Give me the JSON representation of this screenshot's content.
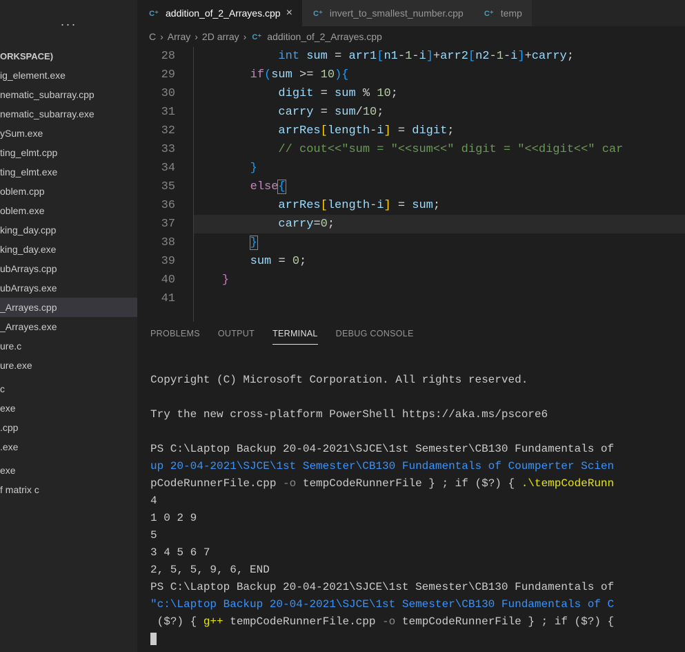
{
  "sidebar": {
    "workspace_label": "ORKSPACE)",
    "files": [
      "ig_element.exe",
      "nematic_subarray.cpp",
      "nematic_subarray.exe",
      "ySum.exe",
      "ting_elmt.cpp",
      "ting_elmt.exe",
      "oblem.cpp",
      "oblem.exe",
      "king_day.cpp",
      "king_day.exe",
      "ubArrays.cpp",
      "ubArrays.exe",
      "_Arrayes.cpp",
      "_Arrayes.exe",
      "ure.c",
      "ure.exe",
      "",
      "c",
      "exe",
      ".cpp",
      ".exe",
      "",
      "exe",
      "f matrix c"
    ],
    "active_index": 12
  },
  "tabs": {
    "items": [
      {
        "label": "addition_of_2_Arrayes.cpp",
        "active": true,
        "close": true
      },
      {
        "label": "invert_to_smallest_number.cpp",
        "active": false,
        "close": false
      },
      {
        "label": "temp",
        "active": false,
        "close": false
      }
    ]
  },
  "breadcrumb": {
    "parts": [
      "C",
      "Array",
      "2D array",
      "addition_of_2_Arrayes.cpp"
    ]
  },
  "editor": {
    "line_start": 28,
    "line_end": 41
  },
  "panel": {
    "tabs": [
      "PROBLEMS",
      "OUTPUT",
      "TERMINAL",
      "DEBUG CONSOLE"
    ],
    "active_index": 2
  },
  "terminal": {
    "lines": {
      "copyright": "Copyright (C) Microsoft Corporation. All rights reserved.",
      "try": "Try the new cross-platform PowerShell https://aka.ms/pscore6",
      "ps1_a": "PS C:\\Laptop Backup 20-04-2021\\SJCE\\1st Semester\\CB130 Fundamentals of",
      "ps1_b": "up 20-04-2021\\SJCE\\1st Semester\\CB130 Fundamentals of Coumperter Scien",
      "ps1_c_a": "pCodeRunnerFile.cpp",
      "ps1_c_b": " -o ",
      "ps1_c_c": "tempCodeRunnerFile } ; if ($?) { ",
      "ps1_c_d": ".\\tempCodeRunn",
      "out1": "4",
      "out2": "1 0 2 9",
      "out3": "5",
      "out4": "3 4 5 6 7",
      "out5": "2, 5, 5, 9, 6, END",
      "ps2_a": "PS C:\\Laptop Backup 20-04-2021\\SJCE\\1st Semester\\CB130 Fundamentals of",
      "ps2_b": "\"c:\\Laptop Backup 20-04-2021\\SJCE\\1st Semester\\CB130 Fundamentals of C",
      "ps2_c_a": " ($?) { ",
      "ps2_c_b": "g++",
      "ps2_c_c": " tempCodeRunnerFile.cpp ",
      "ps2_c_d": "-o",
      "ps2_c_e": " tempCodeRunnerFile } ; if ($?) {"
    }
  }
}
